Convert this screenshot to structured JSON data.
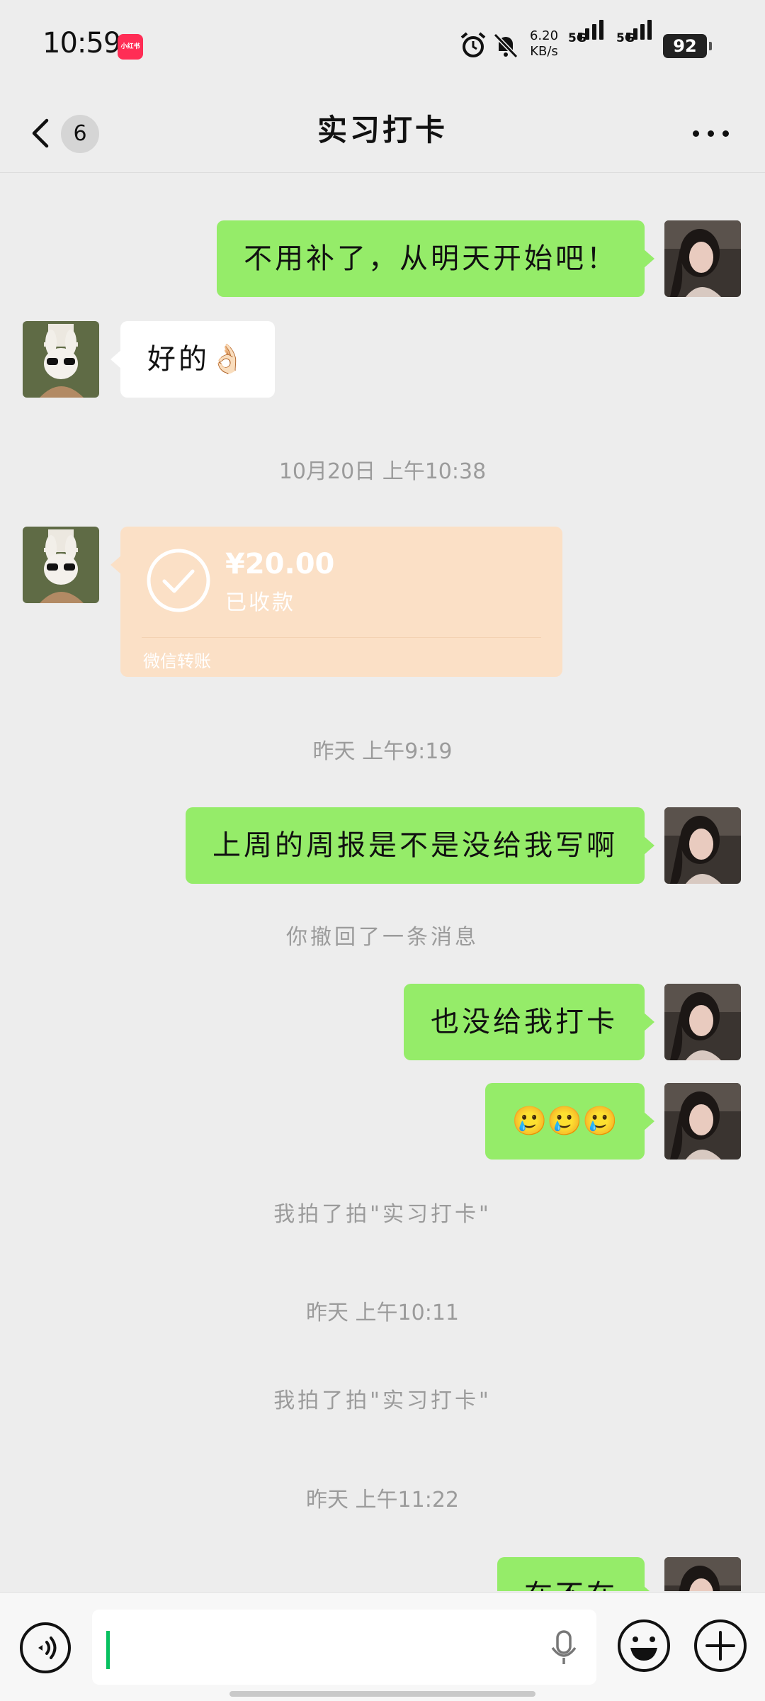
{
  "status_bar": {
    "time": "10:59",
    "app_badge": "小红书",
    "net_speed_value": "6.20",
    "net_speed_unit": "KB/s",
    "signal_1": "5G",
    "signal_2": "5G",
    "battery": "92"
  },
  "nav": {
    "unread_count": "6",
    "title": "实习打卡"
  },
  "messages": {
    "m1": "不用补了，从明天开始吧！",
    "m2": "好的👌🏻",
    "ts1": "10月20日 上午10:38",
    "transfer": {
      "amount": "¥20.00",
      "status": "已收款",
      "label": "微信转账"
    },
    "ts2": "昨天 上午9:19",
    "m3": "上周的周报是不是没给我写啊",
    "recall": "你撤回了一条消息",
    "m4": "也没给我打卡",
    "m5": "🥲🥲🥲",
    "pat1": "我拍了拍\"实习打卡\"",
    "ts3": "昨天 上午10:11",
    "pat2": "我拍了拍\"实习打卡\"",
    "ts4": "昨天 上午11:22",
    "m6": "在不在"
  },
  "colors": {
    "self_bubble": "#95ec69",
    "other_bubble": "#ffffff",
    "transfer_card": "#fbe0c6",
    "caret": "#07c160"
  },
  "icons": [
    "alarm-icon",
    "bell-off-icon",
    "back-icon",
    "more-icon",
    "check-icon",
    "voice-icon",
    "mic-icon",
    "emoji-icon",
    "plus-icon"
  ]
}
